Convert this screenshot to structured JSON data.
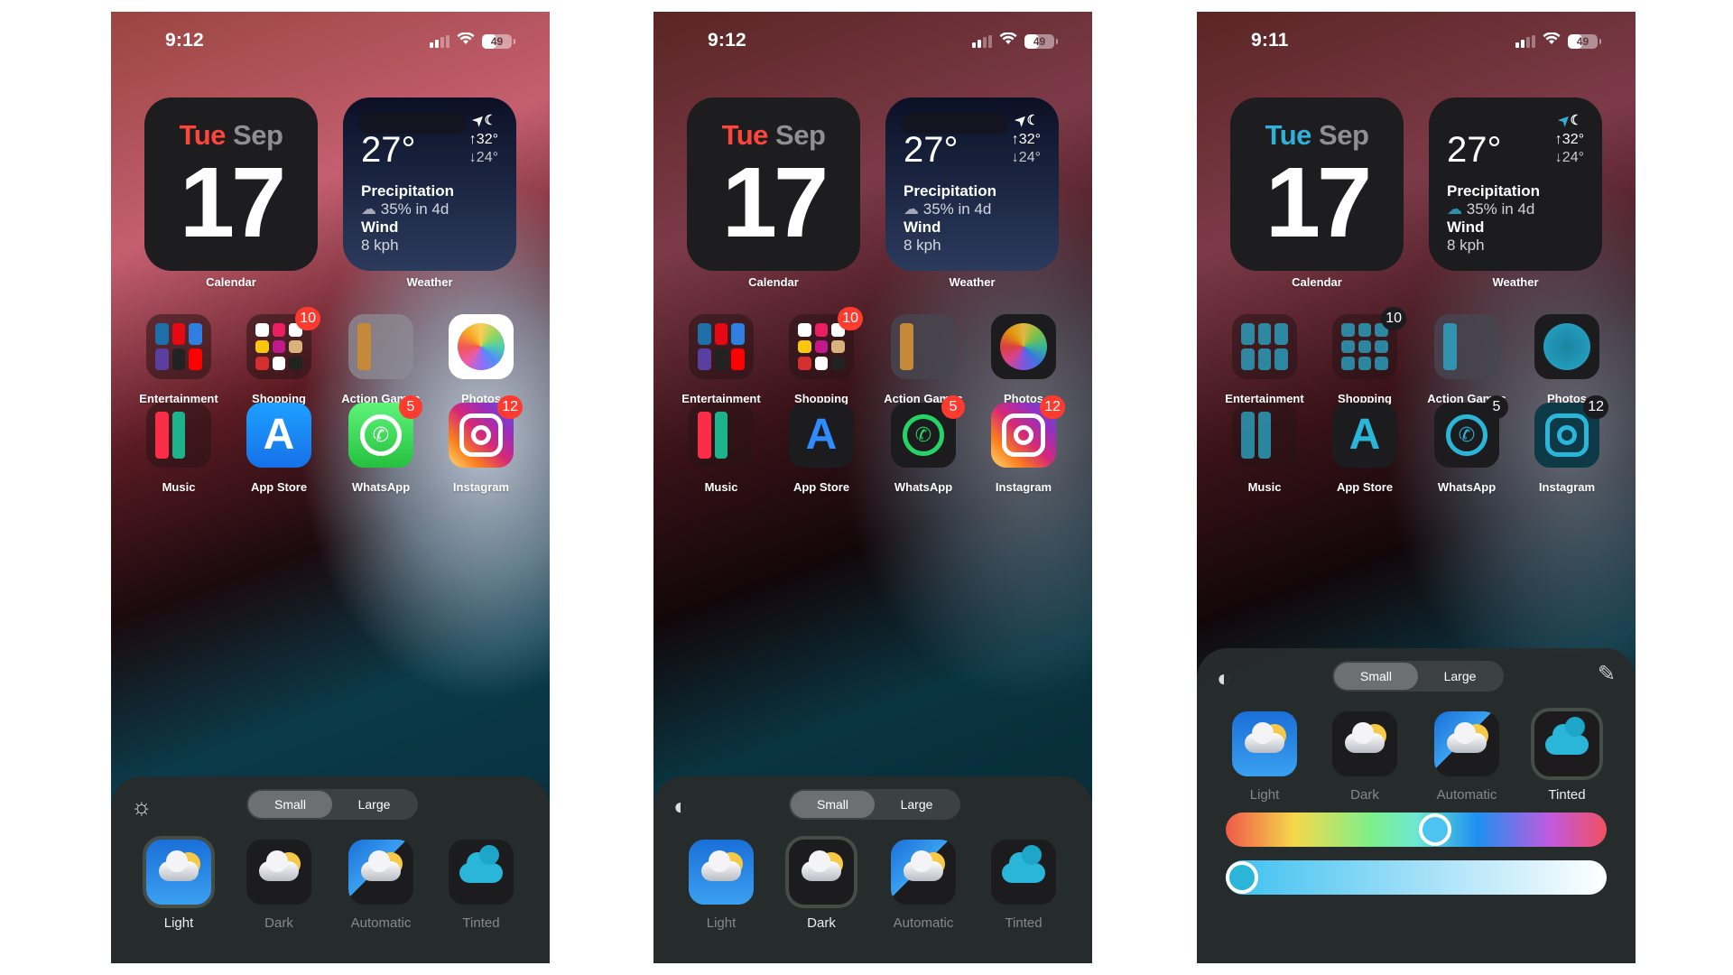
{
  "phones": [
    {
      "status": {
        "time": "9:12",
        "location_arrow": true,
        "battery": "49",
        "battery_level": 0.49
      },
      "calendar": {
        "weekday": "Tue",
        "month": "Sep",
        "day": "17",
        "label": "Calendar",
        "accent": "#ff453a"
      },
      "weather": {
        "temp": "27°",
        "high": "↑32°",
        "low": "↓24°",
        "precip_label": "Precipitation",
        "precip_value": "35% in 4d",
        "wind_label": "Wind",
        "wind_value": "8 kph",
        "label": "Weather"
      },
      "apps": [
        {
          "name": "Entertainment",
          "badge": ""
        },
        {
          "name": "Shopping",
          "badge": "10"
        },
        {
          "name": "Action Games",
          "badge": ""
        },
        {
          "name": "Photos",
          "badge": ""
        },
        {
          "name": "Music",
          "badge": ""
        },
        {
          "name": "App Store",
          "badge": ""
        },
        {
          "name": "WhatsApp",
          "badge": "5"
        },
        {
          "name": "Instagram",
          "badge": "12"
        }
      ],
      "panel": {
        "size_options": [
          "Small",
          "Large"
        ],
        "selected_size": "Small",
        "styles": [
          "Light",
          "Dark",
          "Automatic",
          "Tinted"
        ],
        "selected_style": "Light"
      }
    },
    {
      "status": {
        "time": "9:12",
        "location_arrow": false,
        "battery": "49",
        "battery_level": 0.49
      },
      "calendar": {
        "weekday": "Tue",
        "month": "Sep",
        "day": "17",
        "label": "Calendar",
        "accent": "#ff453a"
      },
      "weather": {
        "temp": "27°",
        "high": "↑32°",
        "low": "↓24°",
        "precip_label": "Precipitation",
        "precip_value": "35% in 4d",
        "wind_label": "Wind",
        "wind_value": "8 kph",
        "label": "Weather"
      },
      "apps": [
        {
          "name": "Entertainment",
          "badge": ""
        },
        {
          "name": "Shopping",
          "badge": "10"
        },
        {
          "name": "Action Games",
          "badge": ""
        },
        {
          "name": "Photos",
          "badge": ""
        },
        {
          "name": "Music",
          "badge": ""
        },
        {
          "name": "App Store",
          "badge": ""
        },
        {
          "name": "WhatsApp",
          "badge": "5"
        },
        {
          "name": "Instagram",
          "badge": "12"
        }
      ],
      "panel": {
        "size_options": [
          "Small",
          "Large"
        ],
        "selected_size": "Small",
        "styles": [
          "Light",
          "Dark",
          "Automatic",
          "Tinted"
        ],
        "selected_style": "Dark"
      }
    },
    {
      "status": {
        "time": "9:11",
        "location_arrow": false,
        "battery": "49",
        "battery_level": 0.49
      },
      "calendar": {
        "weekday": "Tue",
        "month": "Sep",
        "day": "17",
        "label": "Calendar",
        "accent": "#30b0d8"
      },
      "weather": {
        "temp": "27°",
        "high": "↑32°",
        "low": "↓24°",
        "precip_label": "Precipitation",
        "precip_value": "35% in 4d",
        "wind_label": "Wind",
        "wind_value": "8 kph",
        "label": "Weather"
      },
      "apps": [
        {
          "name": "Entertainment",
          "badge": ""
        },
        {
          "name": "Shopping",
          "badge": "10"
        },
        {
          "name": "Action Games",
          "badge": ""
        },
        {
          "name": "Photos",
          "badge": ""
        },
        {
          "name": "Music",
          "badge": ""
        },
        {
          "name": "App Store",
          "badge": ""
        },
        {
          "name": "WhatsApp",
          "badge": "5"
        },
        {
          "name": "Instagram",
          "badge": "12"
        }
      ],
      "panel": {
        "size_options": [
          "Small",
          "Large"
        ],
        "selected_size": "Small",
        "styles": [
          "Light",
          "Dark",
          "Automatic",
          "Tinted"
        ],
        "selected_style": "Tinted",
        "hue_value": 0.55,
        "saturation_value": 0.0,
        "tint_color": "#29b6d8"
      }
    }
  ]
}
